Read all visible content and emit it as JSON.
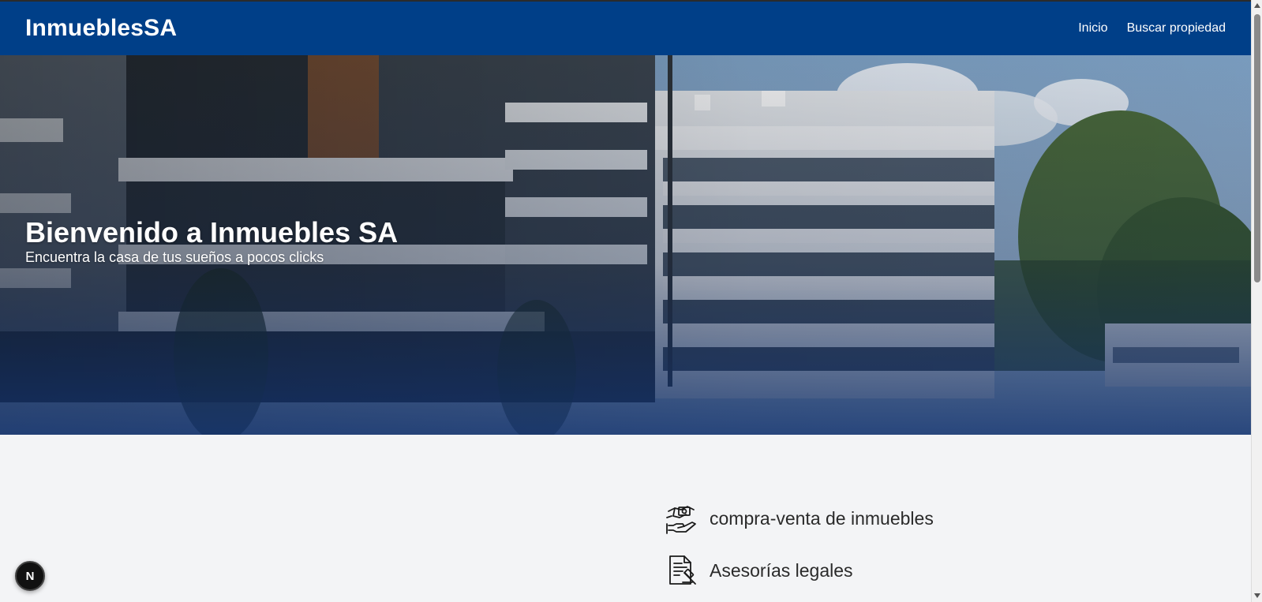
{
  "navbar": {
    "brand": "InmueblesSA",
    "links": [
      {
        "label": "Inicio"
      },
      {
        "label": "Buscar propiedad"
      }
    ],
    "background": "#003f88"
  },
  "hero": {
    "title": "Bienvenido a Inmuebles SA",
    "subtitle": "Encuentra la casa de tus sueños a pocos clicks"
  },
  "services": [
    {
      "label": "compra-venta de inmuebles",
      "icon": "handshake-money-icon"
    },
    {
      "label": "Asesorías legales",
      "icon": "legal-document-icon"
    }
  ],
  "dev_badge": {
    "label": "N"
  }
}
